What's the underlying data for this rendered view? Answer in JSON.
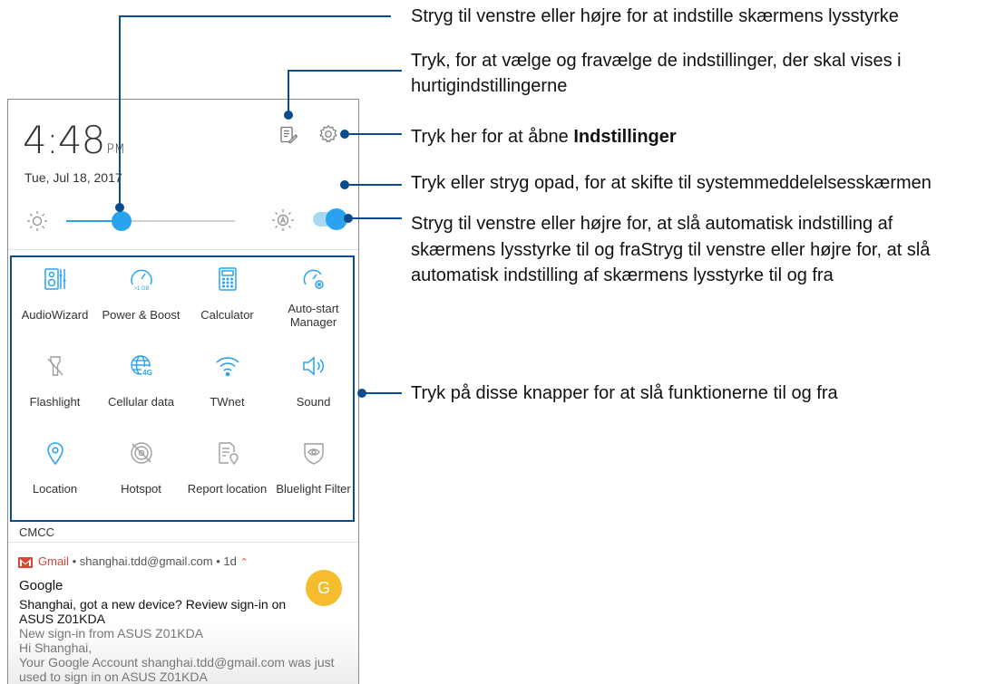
{
  "status": {
    "time": "4:48",
    "ampm": "PM",
    "date": "Tue, Jul 18, 2017"
  },
  "brightness": {
    "level": 0.33,
    "auto": true
  },
  "tiles": [
    {
      "label": "AudioWizard",
      "icon": "audiowizard-icon",
      "active": true
    },
    {
      "label": "Power & Boost",
      "icon": "power-boost-icon",
      "active": true,
      "badge": ">1 GB"
    },
    {
      "label": "Calculator",
      "icon": "calculator-icon",
      "active": true
    },
    {
      "label": "Auto-start Manager",
      "icon": "auto-start-icon",
      "active": true
    },
    {
      "label": "Flashlight",
      "icon": "flashlight-icon",
      "active": false
    },
    {
      "label": "Cellular data",
      "icon": "cellular-data-icon",
      "active": true,
      "badge": "4G"
    },
    {
      "label": "TWnet",
      "icon": "wifi-icon",
      "active": true
    },
    {
      "label": "Sound",
      "icon": "sound-icon",
      "active": true
    },
    {
      "label": "Location",
      "icon": "location-icon",
      "active": true
    },
    {
      "label": "Hotspot",
      "icon": "hotspot-icon",
      "active": false
    },
    {
      "label": "Report location",
      "icon": "report-location-icon",
      "active": false
    },
    {
      "label": "Bluelight Filter",
      "icon": "bluelight-filter-icon",
      "active": false
    }
  ],
  "carrier": "CMCC",
  "notification": {
    "app": "Gmail",
    "meta": " • shanghai.tdd@gmail.com • 1d",
    "title": "Google",
    "body": [
      "Shanghai, got a new device? Review sign-in on",
      "ASUS Z01KDA",
      "New sign-in from ASUS Z01KDA",
      "Hi Shanghai,",
      "Your Google Account shanghai.tdd@gmail.com was just",
      "used to sign in on ASUS Z01KDA"
    ],
    "avatar": "G"
  },
  "callouts": {
    "brightness": "Stryg til venstre eller højre for at indstille skærmens lysstyrke",
    "edit_line1": "Tryk, for at vælge og fravælge de indstillinger, der skal vises i",
    "edit_line2": "hurtigindstillingerne",
    "settings_prefix": "Tryk her for at åbne ",
    "settings_bold": "Indstillinger",
    "swipe": "Tryk eller stryg opad, for at skifte til systemmeddelelsesskærmen",
    "auto_line1": "Stryg til venstre eller højre for, at slå automatisk indstilling af",
    "auto_line2": "skærmens lysstyrke til og fraStryg til venstre eller højre for, at slå",
    "auto_line3": "automatisk indstilling af skærmens lysstyrke til og fra",
    "buttons": "Tryk på disse knapper for at slå funktionerne til og fra"
  },
  "colors": {
    "accent": "#29a3ee",
    "callout": "#0a4c8d",
    "inactive": "#9e9e9e",
    "gmail": "#db4437",
    "avatar": "#f5bd2d"
  }
}
